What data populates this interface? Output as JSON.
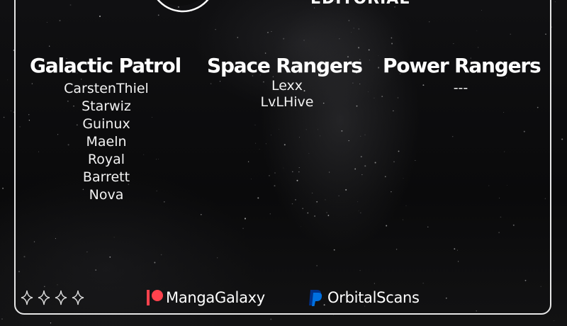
{
  "header": {
    "title": "EDITORIAL"
  },
  "teams": [
    {
      "title": "Galactic Patrol",
      "members": [
        "CarstenThiel",
        "Starwiz",
        "Guinux",
        "Maeln",
        "Royal",
        "Barrett",
        "Nova"
      ]
    },
    {
      "title": "Space Rangers",
      "members": [
        "Lexx",
        "LvLHive"
      ]
    },
    {
      "title": "Power Rangers",
      "members": [
        "---"
      ]
    }
  ],
  "footer": {
    "patreon": {
      "icon": "patreon-icon",
      "name": "MangaGalaxy",
      "color": "#ff424d"
    },
    "paypal": {
      "icon": "paypal-icon",
      "name": "OrbitalScans",
      "color": "#0070e0"
    },
    "decorations": "four-sparkle-icons"
  },
  "colors": {
    "background": "#0b0b0c",
    "frame": "#e6e6e6",
    "text": "#ffffff"
  }
}
